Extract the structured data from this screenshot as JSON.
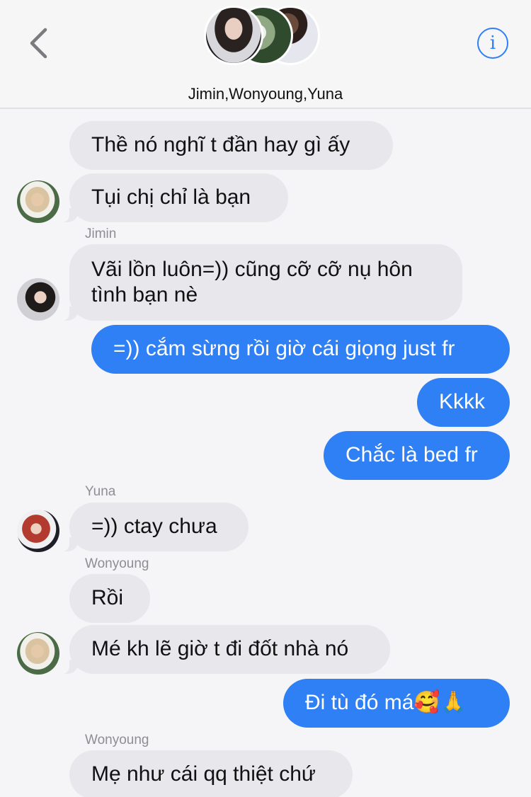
{
  "header": {
    "group_name": "Jimin,Wonyoung,Yuna",
    "back_icon": "chevron-left-icon",
    "info_icon": "info-icon",
    "info_glyph": "i",
    "accent_color": "#2f7ff5"
  },
  "messages": [
    {
      "direction": "incoming",
      "sender": "",
      "text": "Thề nó nghĩ t đần hay gì ấy"
    },
    {
      "direction": "incoming",
      "sender": "",
      "text": "Tụi chị chỉ là bạn"
    },
    {
      "direction": "incoming",
      "sender": "Jimin",
      "text": "Vãi lồn luôn=)) cũng cỡ cỡ nụ hôn tình bạn nè"
    },
    {
      "direction": "outgoing",
      "sender": "",
      "text": "=)) cắm sừng rồi giờ cái giọng just fr"
    },
    {
      "direction": "outgoing",
      "sender": "",
      "text": "Kkkk"
    },
    {
      "direction": "outgoing",
      "sender": "",
      "text": "Chắc là bed fr"
    },
    {
      "direction": "incoming",
      "sender": "Yuna",
      "text": "=)) ctay chưa"
    },
    {
      "direction": "incoming",
      "sender": "Wonyoung",
      "text": "Rồi"
    },
    {
      "direction": "incoming",
      "sender": "",
      "text": "Mé kh lẽ giờ t đi đốt nhà nó"
    },
    {
      "direction": "outgoing",
      "sender": "",
      "text": "Đi tù đó má🥰🙏"
    },
    {
      "direction": "incoming",
      "sender": "Wonyoung",
      "text": "Mẹ như cái qq thiệt chứ"
    }
  ],
  "colors": {
    "incoming_bubble": "#e7e7ec",
    "outgoing_bubble": "#2f7ff5",
    "background": "#f5f5f7"
  }
}
